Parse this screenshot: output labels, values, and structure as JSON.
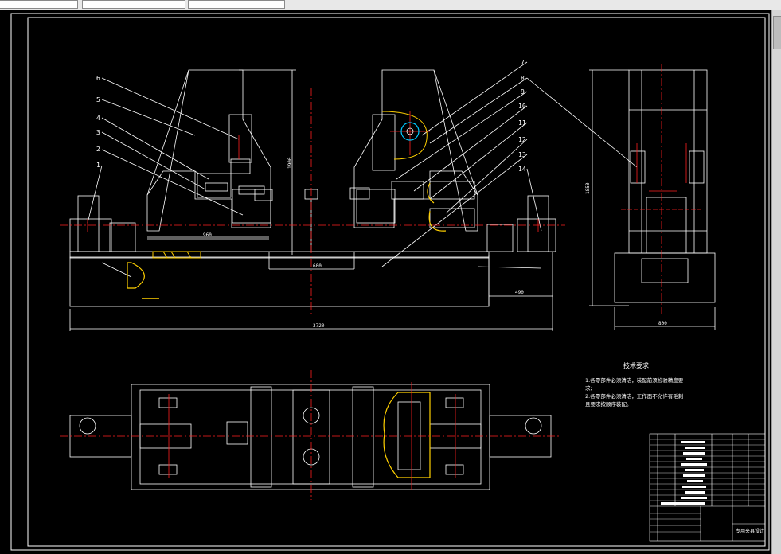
{
  "toolbar": {
    "field1": "",
    "field2": "",
    "field3": ""
  },
  "drawing": {
    "part_numbers": [
      "1",
      "2",
      "3",
      "4",
      "5",
      "6",
      "7",
      "8",
      "9",
      "10",
      "11",
      "12",
      "13",
      "14"
    ],
    "dimensions": {
      "front_span": "960",
      "center_gap": "600",
      "right_offset": "490",
      "total_length": "3720",
      "front_height": "1900",
      "side_height": "1850",
      "side_width": "800"
    },
    "tech_requirements": {
      "title": "技术要求",
      "line1": "1.各零部件必须清洁，装配前须检验精度要",
      "line2": "求;",
      "line3": "2.各零部件必须清洁，工作面不允许有毛刺",
      "line4": "且要求按顺序装配。"
    },
    "title_block": {
      "drawing_name": "专用夹具设计"
    }
  },
  "colors": {
    "line": "#ffffff",
    "center": "#ff2020",
    "hatch": "#ffd000",
    "highlight": "#00c8ff",
    "background": "#000000"
  }
}
